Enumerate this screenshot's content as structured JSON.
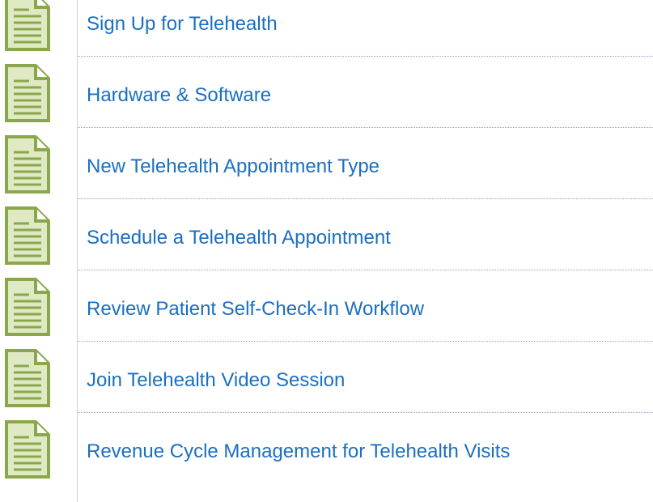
{
  "colors": {
    "link": "#1b6fc1",
    "icon_fill": "#dfe9c4",
    "icon_stroke": "#8ba74c",
    "divider": "#8aa6c8"
  },
  "items": [
    {
      "label": "Sign Up for Telehealth",
      "icon": "document-icon"
    },
    {
      "label": "Hardware & Software",
      "icon": "document-icon"
    },
    {
      "label": "New Telehealth Appointment Type",
      "icon": "document-icon"
    },
    {
      "label": "Schedule a Telehealth Appointment",
      "icon": "document-icon"
    },
    {
      "label": "Review Patient Self-Check-In Workflow",
      "icon": "document-icon"
    },
    {
      "label": "Join Telehealth Video Session",
      "icon": "document-icon"
    },
    {
      "label": "Revenue Cycle Management for Telehealth Visits",
      "icon": "document-icon"
    }
  ]
}
